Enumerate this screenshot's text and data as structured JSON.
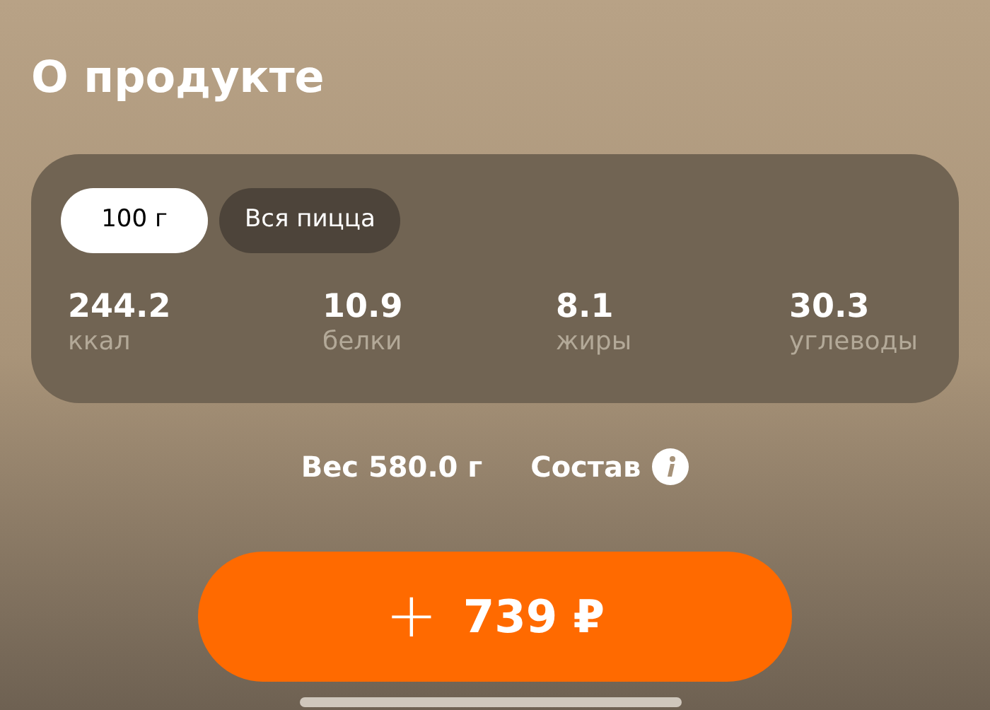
{
  "title": "О продукте",
  "portion_tabs": [
    {
      "label": "100 г",
      "selected": true
    },
    {
      "label": "Вся пицца",
      "selected": false
    }
  ],
  "nutrients": [
    {
      "value": "244.2",
      "label": "ккал"
    },
    {
      "value": "10.9",
      "label": "белки"
    },
    {
      "value": "8.1",
      "label": "жиры"
    },
    {
      "value": "30.3",
      "label": "углеводы"
    }
  ],
  "weight": "Вес 580.0 г",
  "ingredients_link": "Состав",
  "add_button": {
    "icon": "+",
    "price": "739 ₽"
  }
}
